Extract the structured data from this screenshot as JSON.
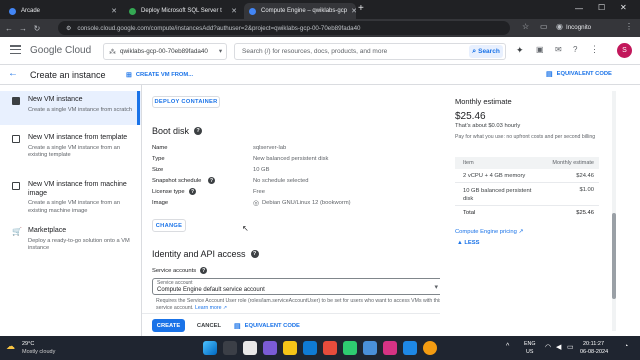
{
  "browser": {
    "tabs": [
      {
        "title": "Arcade",
        "active": false,
        "favicon_color": "#4285f4"
      },
      {
        "title": "Deploy Microsoft SQL Server t",
        "active": false,
        "favicon_color": "#34a853"
      },
      {
        "title": "Compute Engine – qwiklabs-gcp",
        "active": true,
        "favicon_color": "#4285f4"
      }
    ],
    "new_tab": "+",
    "url": "console.cloud.google.com/compute/instancesAdd?authuser=2&project=qwiklabs-gcp-00-70eb89fada40",
    "profile": "Incognito"
  },
  "header": {
    "logo_google": "Google",
    "logo_cloud": "Cloud",
    "project": "qwiklabs-gcp-00-70eb89fada40",
    "search_placeholder": "Search (/) for resources, docs, products, and more",
    "search_button": "Search",
    "avatar": "S"
  },
  "titlebar": {
    "title": "Create an instance",
    "create_vm_from": "CREATE VM FROM...",
    "equivalent_code": "EQUIVALENT CODE"
  },
  "sidebar": {
    "items": [
      {
        "title": "New VM instance",
        "desc": "Create a single VM instance from scratch",
        "selected": true
      },
      {
        "title": "New VM instance from template",
        "desc": "Create a single VM instance from an existing template",
        "selected": false
      },
      {
        "title": "New VM instance from machine image",
        "desc": "Create a single VM instance from an existing machine image",
        "selected": false
      },
      {
        "title": "Marketplace",
        "desc": "Deploy a ready-to-go solution onto a VM instance",
        "selected": false
      }
    ]
  },
  "main": {
    "deploy_container": "DEPLOY CONTAINER",
    "boot_disk": {
      "heading": "Boot disk",
      "rows": [
        {
          "label": "Name",
          "value": "sqlserver-lab"
        },
        {
          "label": "Type",
          "value": "New balanced persistent disk"
        },
        {
          "label": "Size",
          "value": "10 GB"
        },
        {
          "label": "Snapshot schedule",
          "value": "No schedule selected"
        },
        {
          "label": "License type",
          "value": "Free"
        },
        {
          "label": "Image",
          "value": "Debian GNU/Linux 12 (bookworm)"
        }
      ],
      "change": "CHANGE"
    },
    "identity": {
      "heading": "Identity and API access",
      "service_accounts_label": "Service accounts",
      "service_account_field_label": "Service account",
      "service_account_value": "Compute Engine default service account",
      "hint": "Requires the Service Account User role (roles/iam.serviceAccountUser) to be set for users who want to access VMs with this service account.",
      "learn_more": "Learn more"
    },
    "footer": {
      "create": "CREATE",
      "cancel": "CANCEL",
      "equivalent_code": "EQUIVALENT CODE"
    }
  },
  "estimate": {
    "heading": "Monthly estimate",
    "price": "$25.46",
    "hourly": "That's about $0.03 hourly",
    "note": "Pay for what you use: no upfront costs and per second billing",
    "table_header": {
      "item": "Item",
      "cost": "Monthly estimate"
    },
    "rows": [
      {
        "item": "2 vCPU + 4 GB memory",
        "cost": "$24.46"
      },
      {
        "item": "10 GB balanced persistent disk",
        "cost": "$1.00"
      }
    ],
    "total_label": "Total",
    "total": "$25.46",
    "pricing_link": "Compute Engine pricing",
    "less": "LESS"
  },
  "taskbar": {
    "temp": "29°C",
    "weather": "Mostly cloudy",
    "lang": "ENG",
    "region": "US",
    "time": "20:11:27",
    "date": "06-08-2024"
  },
  "colors": {
    "accent": "#1a73e8",
    "selected_bg": "#e8f0fe"
  }
}
